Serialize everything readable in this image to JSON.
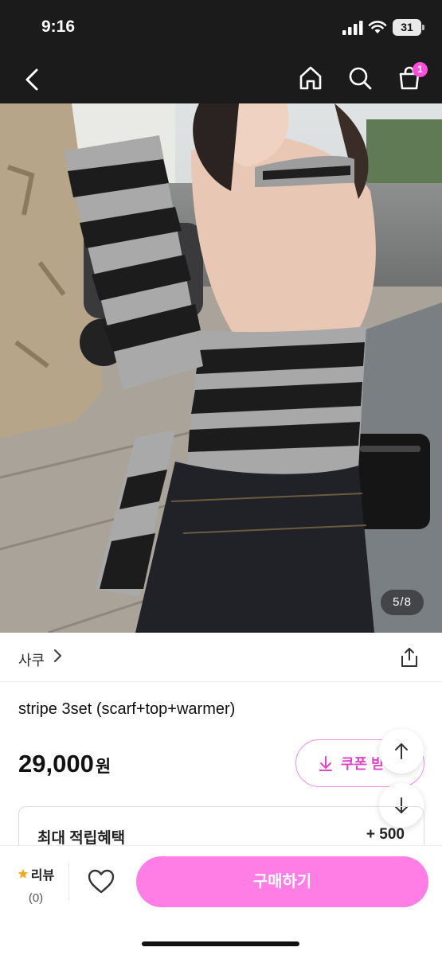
{
  "status_bar": {
    "time": "9:16",
    "battery": "31"
  },
  "header": {
    "cart_badge": "1",
    "icons": [
      "back-icon",
      "home-icon",
      "search-icon",
      "cart-icon"
    ]
  },
  "gallery": {
    "counter": "5/8"
  },
  "product": {
    "seller": "사쿠",
    "title": "stripe 3set (scarf+top+warmer)",
    "price": "29,000",
    "currency": "원",
    "coupon_label": "쿠폰 받",
    "benefit_label": "최대 적립혜택",
    "benefit_value": "+ 500"
  },
  "bottom_bar": {
    "review_label": "리뷰",
    "review_count": "(0)",
    "buy_label": "구매하기"
  },
  "colors": {
    "accent_pink": "#ff7ee6",
    "coupon_text": "#e044c8",
    "header_bg": "#1b1b1b"
  }
}
